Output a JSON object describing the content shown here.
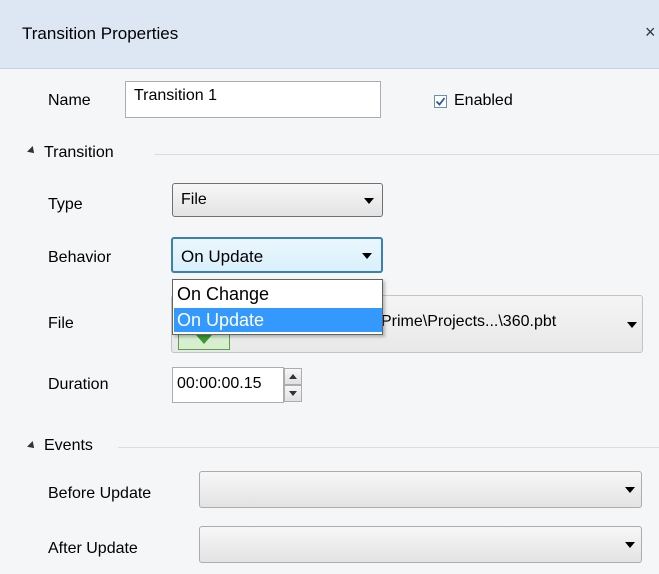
{
  "window": {
    "title": "Transition Properties",
    "close_glyph": "×"
  },
  "name_row": {
    "label": "Name",
    "value": "Transition 1",
    "enabled_label": "Enabled",
    "enabled_checked": true
  },
  "transition_section": {
    "header": "Transition",
    "type_label": "Type",
    "type_value": "File",
    "behavior_label": "Behavior",
    "behavior_value": "On Update",
    "behavior_options": [
      "On Change",
      "On Update"
    ],
    "behavior_highlighted": "On Update",
    "file_label": "File",
    "file_value": "Prime\\Projects...\\360.pbt",
    "duration_label": "Duration",
    "duration_value": "00:00:00.15"
  },
  "events_section": {
    "header": "Events",
    "before_update_label": "Before Update",
    "before_update_value": "",
    "after_update_label": "After Update",
    "after_update_value": ""
  },
  "colors": {
    "titlebar_bg": "#dce7f3",
    "panel_bg": "#f5f6f7",
    "selection_bg": "#3399ff",
    "focus_border": "#3c7fb1"
  }
}
